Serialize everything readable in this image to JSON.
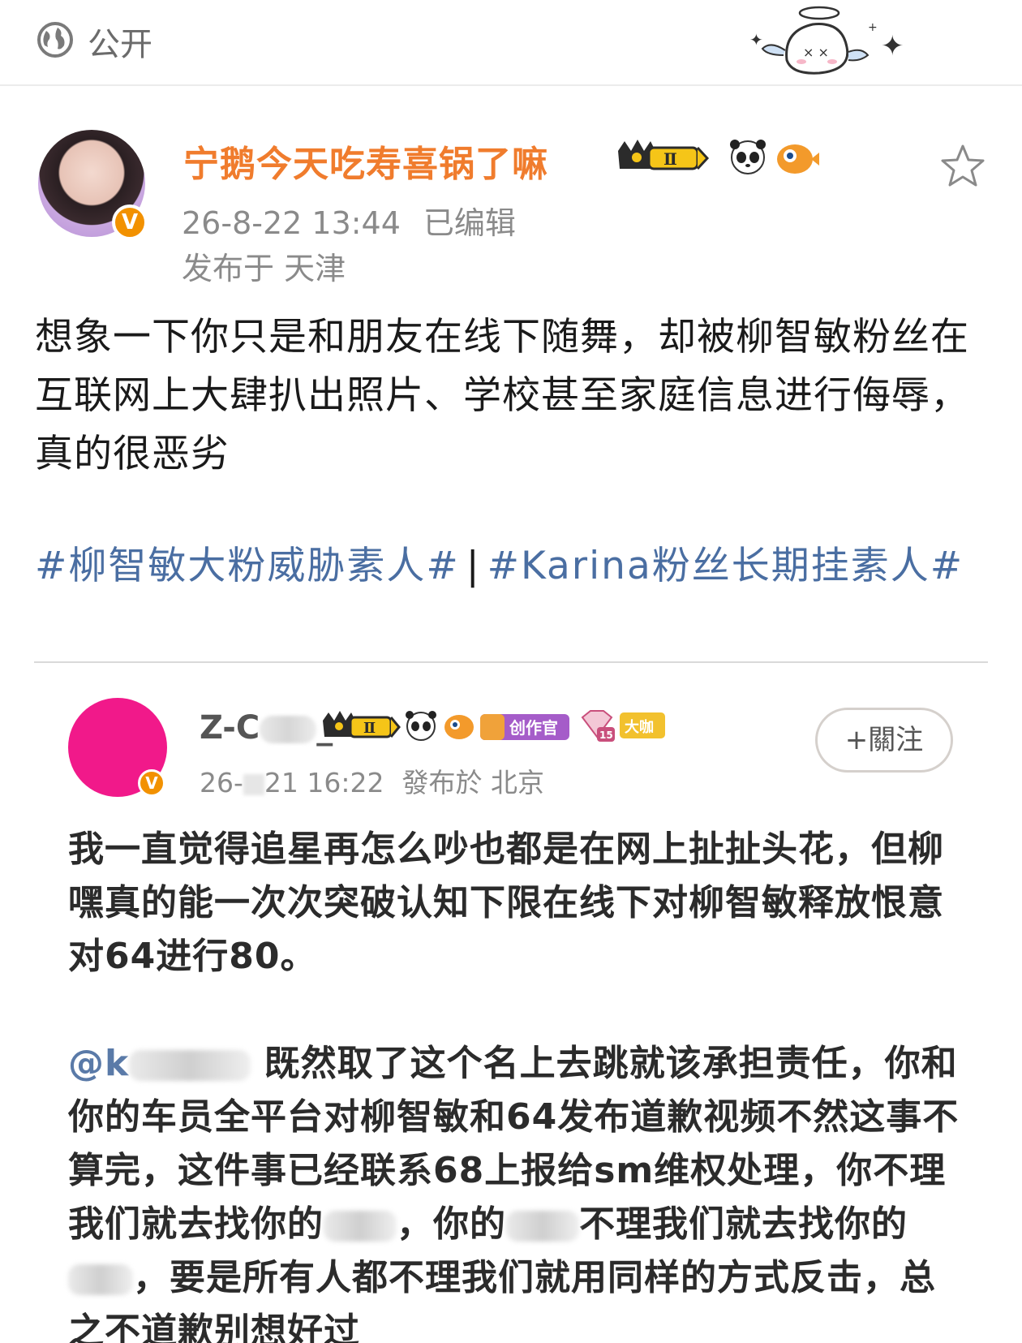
{
  "topbar": {
    "visibility_icon": "globe-icon",
    "visibility_label": "公开"
  },
  "post": {
    "author": "宁鹅今天吃寿喜锅了嘛",
    "verified_icon": "verified-v-icon",
    "vip_badge": "Ⅱ",
    "timestamp": "26-8-22 13:44",
    "edited": "已编辑",
    "location": "发布于 天津",
    "text": "想象一下你只是和朋友在线下随舞，却被柳智敏粉丝在互联网上大肆扒出照片、学校甚至家庭信息进行侮辱，真的很恶劣",
    "tags": [
      "#柳智敏大粉威胁素人#",
      "#Karina粉丝长期挂素人#"
    ],
    "tag_separator": "|"
  },
  "embedded": {
    "author_prefix": "Z-C",
    "author_suffix": "_",
    "vip_badge": "Ⅱ",
    "creator_badge": "创作官",
    "level_badge": "15",
    "big_badge": "大咖",
    "follow_label": "+關注",
    "timestamp_prefix": "26-",
    "timestamp_suffix": "21 16:22",
    "location": "發布於 北京",
    "paragraph1": "我一直觉得追星再怎么吵也都是在网上扯扯头花，但柳嘿真的能一次次突破认知下限在线下对柳智敏释放恨意对64进行80。",
    "mention": "@k",
    "p2_a": "既然取了这个名上去跳就该承担责任，你和你的车员全平台对柳智敏和64发布道歉视频不然这事不算完，这件事已经联系68上报给sm维权处理，你不理我们就去找你的",
    "p2_b": "，你的",
    "p2_c": "不理我们就去找你的",
    "p2_d": "，要是所有人都不理我们就用同样的方式反击，总之不道歉别想好过"
  },
  "colors": {
    "username": "#f07c2d",
    "tag": "#4a6ea2",
    "verified": "#f29100",
    "embedded_avatar": "#f1198a"
  }
}
